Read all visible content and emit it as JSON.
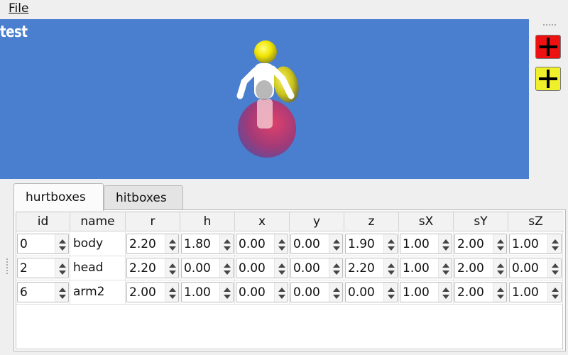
{
  "menu": {
    "file": "File"
  },
  "viewport": {
    "label": "test",
    "background": "#4a7ece"
  },
  "toolbar": {
    "buttons": [
      {
        "icon": "plus-icon",
        "color": "#ee1111"
      },
      {
        "icon": "plus-icon",
        "color": "#f0f02a"
      }
    ]
  },
  "tabs": [
    {
      "label": "hurtboxes",
      "active": true
    },
    {
      "label": "hitboxes",
      "active": false
    }
  ],
  "table": {
    "columns": [
      "id",
      "name",
      "r",
      "h",
      "x",
      "y",
      "z",
      "sX",
      "sY",
      "sZ"
    ],
    "rows": [
      [
        "0",
        "body",
        "2.20",
        "1.80",
        "0.00",
        "0.00",
        "1.90",
        "1.00",
        "2.00",
        "1.00"
      ],
      [
        "2",
        "head",
        "2.20",
        "0.00",
        "0.00",
        "0.00",
        "2.20",
        "1.00",
        "2.00",
        "0.00"
      ],
      [
        "6",
        "arm2",
        "2.00",
        "1.00",
        "0.00",
        "0.00",
        "0.00",
        "1.00",
        "2.00",
        "1.00"
      ]
    ]
  }
}
